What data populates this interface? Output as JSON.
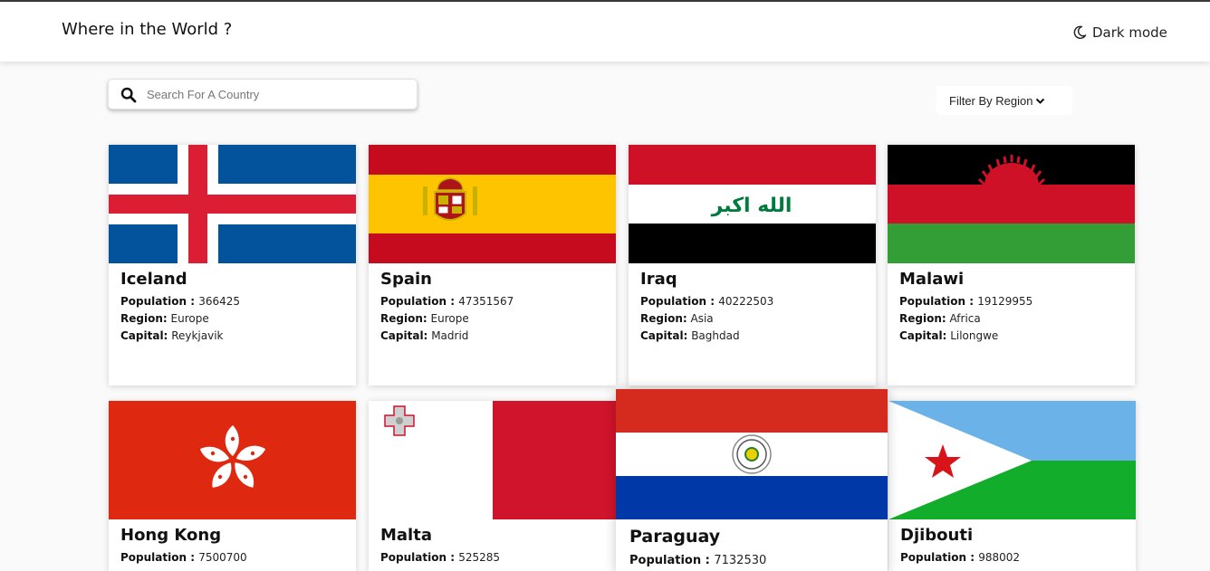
{
  "header": {
    "title": "Where in the World ?",
    "dark_mode_label": "Dark mode",
    "dark_mode_icon": "moon-icon"
  },
  "search": {
    "placeholder": "Search For A Country",
    "value": "",
    "icon": "search-icon"
  },
  "filter": {
    "label": "Filter By Region",
    "icon": "chevron-down-icon"
  },
  "labels": {
    "population": "Population : ",
    "region": "Region:",
    "capital": "Capital:"
  },
  "countries": [
    {
      "name": "Iceland",
      "population": "366425",
      "region": "Europe",
      "capital": "Reykjavik",
      "flag": "iceland-flag"
    },
    {
      "name": "Spain",
      "population": "47351567",
      "region": "Europe",
      "capital": "Madrid",
      "flag": "spain-flag"
    },
    {
      "name": "Iraq",
      "population": "40222503",
      "region": "Asia",
      "capital": "Baghdad",
      "flag": "iraq-flag",
      "flag_text": "الله اكبر"
    },
    {
      "name": "Malawi",
      "population": "19129955",
      "region": "Africa",
      "capital": "Lilongwe",
      "flag": "malawi-flag"
    },
    {
      "name": "Hong Kong",
      "population": "7500700",
      "flag": "hong-kong-flag"
    },
    {
      "name": "Malta",
      "population": "525285",
      "flag": "malta-flag"
    },
    {
      "name": "Paraguay",
      "population": "7132530",
      "flag": "paraguay-flag"
    },
    {
      "name": "Djibouti",
      "population": "988002",
      "flag": "djibouti-flag"
    }
  ],
  "colors": {
    "header_bg": "#ffffff",
    "page_bg": "#fafafa",
    "text": "#111111"
  }
}
